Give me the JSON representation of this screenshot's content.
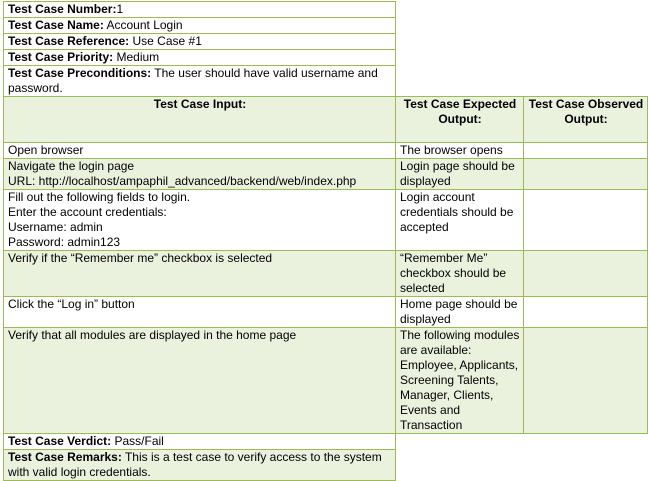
{
  "meta": {
    "number": {
      "label": "Test Case Number:",
      "value": "1"
    },
    "name": {
      "label": "Test Case Name:",
      "value": " Account Login"
    },
    "reference": {
      "label": "Test Case Reference:",
      "value": " Use Case #1"
    },
    "priority": {
      "label": "Test Case Priority:",
      "value": " Medium"
    },
    "preconditions": {
      "label": "Test Case Preconditions:",
      "value": " The user should have valid username and password."
    }
  },
  "headers": {
    "input": "Test Case Input:",
    "expected": "Test Case Expected Output:",
    "observed": "Test Case Observed Output:"
  },
  "steps": [
    {
      "input": [
        "Open browser"
      ],
      "expected": "The browser opens",
      "observed": ""
    },
    {
      "input": [
        "Navigate the login page",
        "URL: http://localhost/ampaphil_advanced/backend/web/index.php"
      ],
      "expected": "Login page should be displayed",
      "observed": ""
    },
    {
      "input": [
        "Fill out the following fields to login.",
        "Enter the account credentials:",
        "Username: admin",
        "Password: admin123"
      ],
      "expected": "Login account credentials should be accepted",
      "observed": ""
    },
    {
      "input": [
        "Verify if the “Remember me” checkbox is selected"
      ],
      "expected": "“Remember Me” checkbox should be selected",
      "observed": ""
    },
    {
      "input": [
        "Click the “Log in” button"
      ],
      "expected": "Home page should be displayed",
      "observed": ""
    },
    {
      "input": [
        "Verify that all modules are displayed in the home page"
      ],
      "expected": "The following modules are available: Employee, Applicants, Screening Talents, Manager, Clients, Events and Transaction",
      "observed": ""
    }
  ],
  "footer": {
    "verdict": {
      "label": "Test Case Verdict:",
      "value": " Pass/Fail"
    },
    "remarks": {
      "label": "Test Case Remarks:",
      "value": " This is a test case to verify access to the system with valid login credentials."
    }
  },
  "colors": {
    "border": "#9bbb59",
    "shade": "#eaf1dd"
  }
}
